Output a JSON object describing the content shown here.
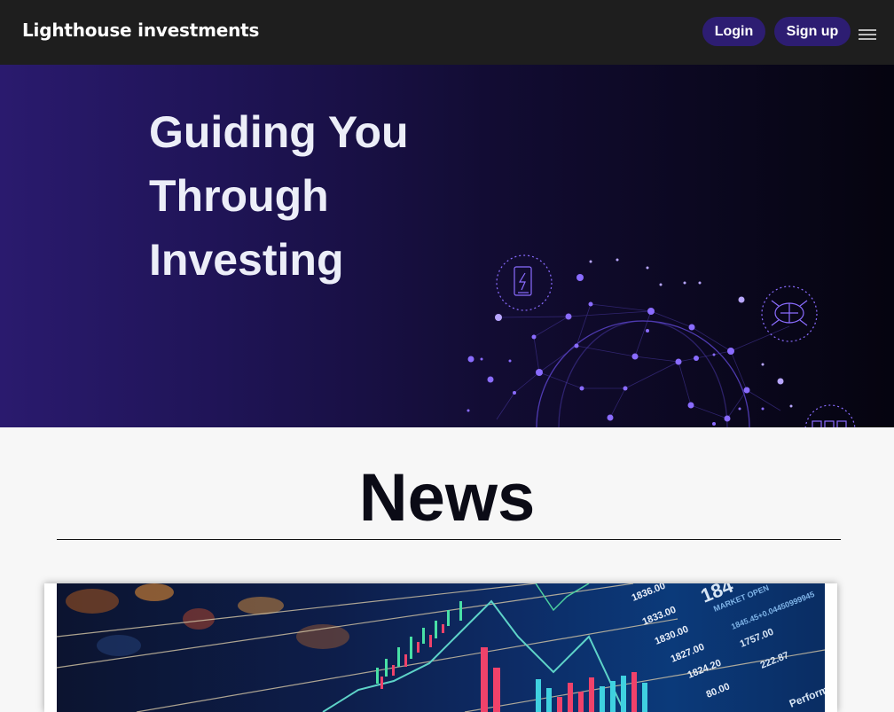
{
  "nav": {
    "brand": "Lighthouse investments",
    "login_label": "Login",
    "signup_label": "Sign up",
    "menu_icon": "hamburger-menu-icon"
  },
  "hero": {
    "title_lines": [
      "Guiding You",
      "Through",
      "Investing"
    ]
  },
  "news": {
    "heading": "News",
    "card": {
      "image": "stock-market-chart-image",
      "price_labels": [
        "1836.00",
        "1833.00",
        "1830.00",
        "1827.00",
        "1824.20",
        "80.00"
      ],
      "right_labels": [
        "184",
        "MARKET OPEN",
        "1845.45+0.04450999945",
        "1757.00",
        "222.87",
        "Perform"
      ]
    }
  },
  "colors": {
    "navbar_bg": "#1e1e1e",
    "button_bg": "#2d1d72",
    "hero_left": "#2a1a6e",
    "hero_right": "#05040f",
    "page_bg": "#f7f7f7"
  }
}
